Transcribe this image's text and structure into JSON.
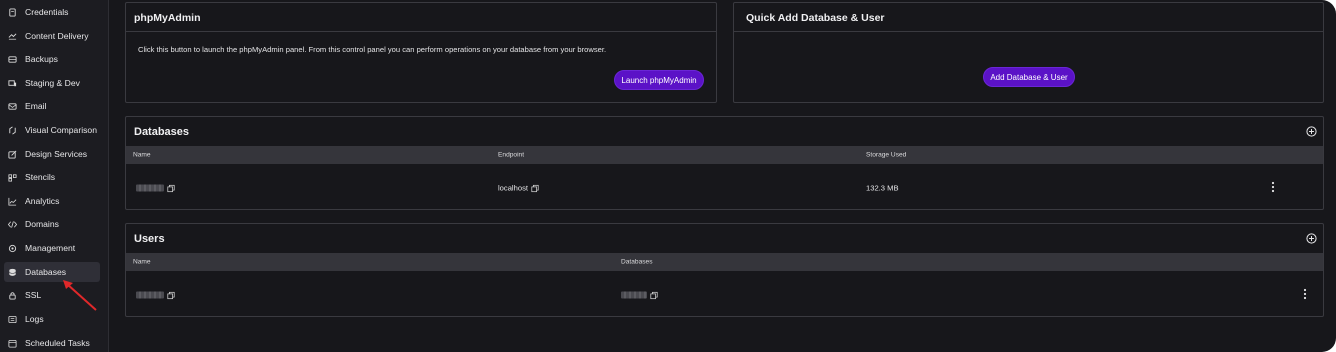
{
  "sidebar": {
    "items": [
      {
        "label": "Credentials",
        "icon": "credentials-icon"
      },
      {
        "label": "Content Delivery",
        "icon": "content-delivery-icon"
      },
      {
        "label": "Backups",
        "icon": "backups-icon"
      },
      {
        "label": "Staging & Dev",
        "icon": "staging-icon"
      },
      {
        "label": "Email",
        "icon": "email-icon"
      },
      {
        "label": "Visual Comparison",
        "icon": "visual-comparison-icon"
      },
      {
        "label": "Design Services",
        "icon": "design-services-icon"
      },
      {
        "label": "Stencils",
        "icon": "stencils-icon"
      },
      {
        "label": "Analytics",
        "icon": "analytics-icon"
      },
      {
        "label": "Domains",
        "icon": "code-icon"
      },
      {
        "label": "Management",
        "icon": "gear-icon"
      },
      {
        "label": "Databases",
        "icon": "database-icon"
      },
      {
        "label": "SSL",
        "icon": "lock-icon"
      },
      {
        "label": "Logs",
        "icon": "logs-icon"
      },
      {
        "label": "Scheduled Tasks",
        "icon": "clock-icon"
      }
    ],
    "active": "Databases"
  },
  "phpmyadmin": {
    "title": "phpMyAdmin",
    "description": "Click this button to launch the phpMyAdmin panel. From this control panel you can perform operations on your database from your browser.",
    "button_label": "Launch phpMyAdmin"
  },
  "quick_add": {
    "title": "Quick Add Database & User",
    "button_label": "Add Database & User"
  },
  "databases": {
    "title": "Databases",
    "columns": [
      "Name",
      "Endpoint",
      "Storage Used"
    ],
    "rows": [
      {
        "name": "",
        "endpoint": "localhost",
        "storage": "132.3 MB"
      }
    ]
  },
  "users": {
    "title": "Users",
    "columns": [
      "Name",
      "Databases"
    ],
    "rows": [
      {
        "name": "",
        "databases": ""
      }
    ]
  },
  "colors": {
    "accent": "#5b12c7",
    "background": "#17171b",
    "table_header": "#35353b",
    "annotation_arrow": "#e0282a"
  }
}
